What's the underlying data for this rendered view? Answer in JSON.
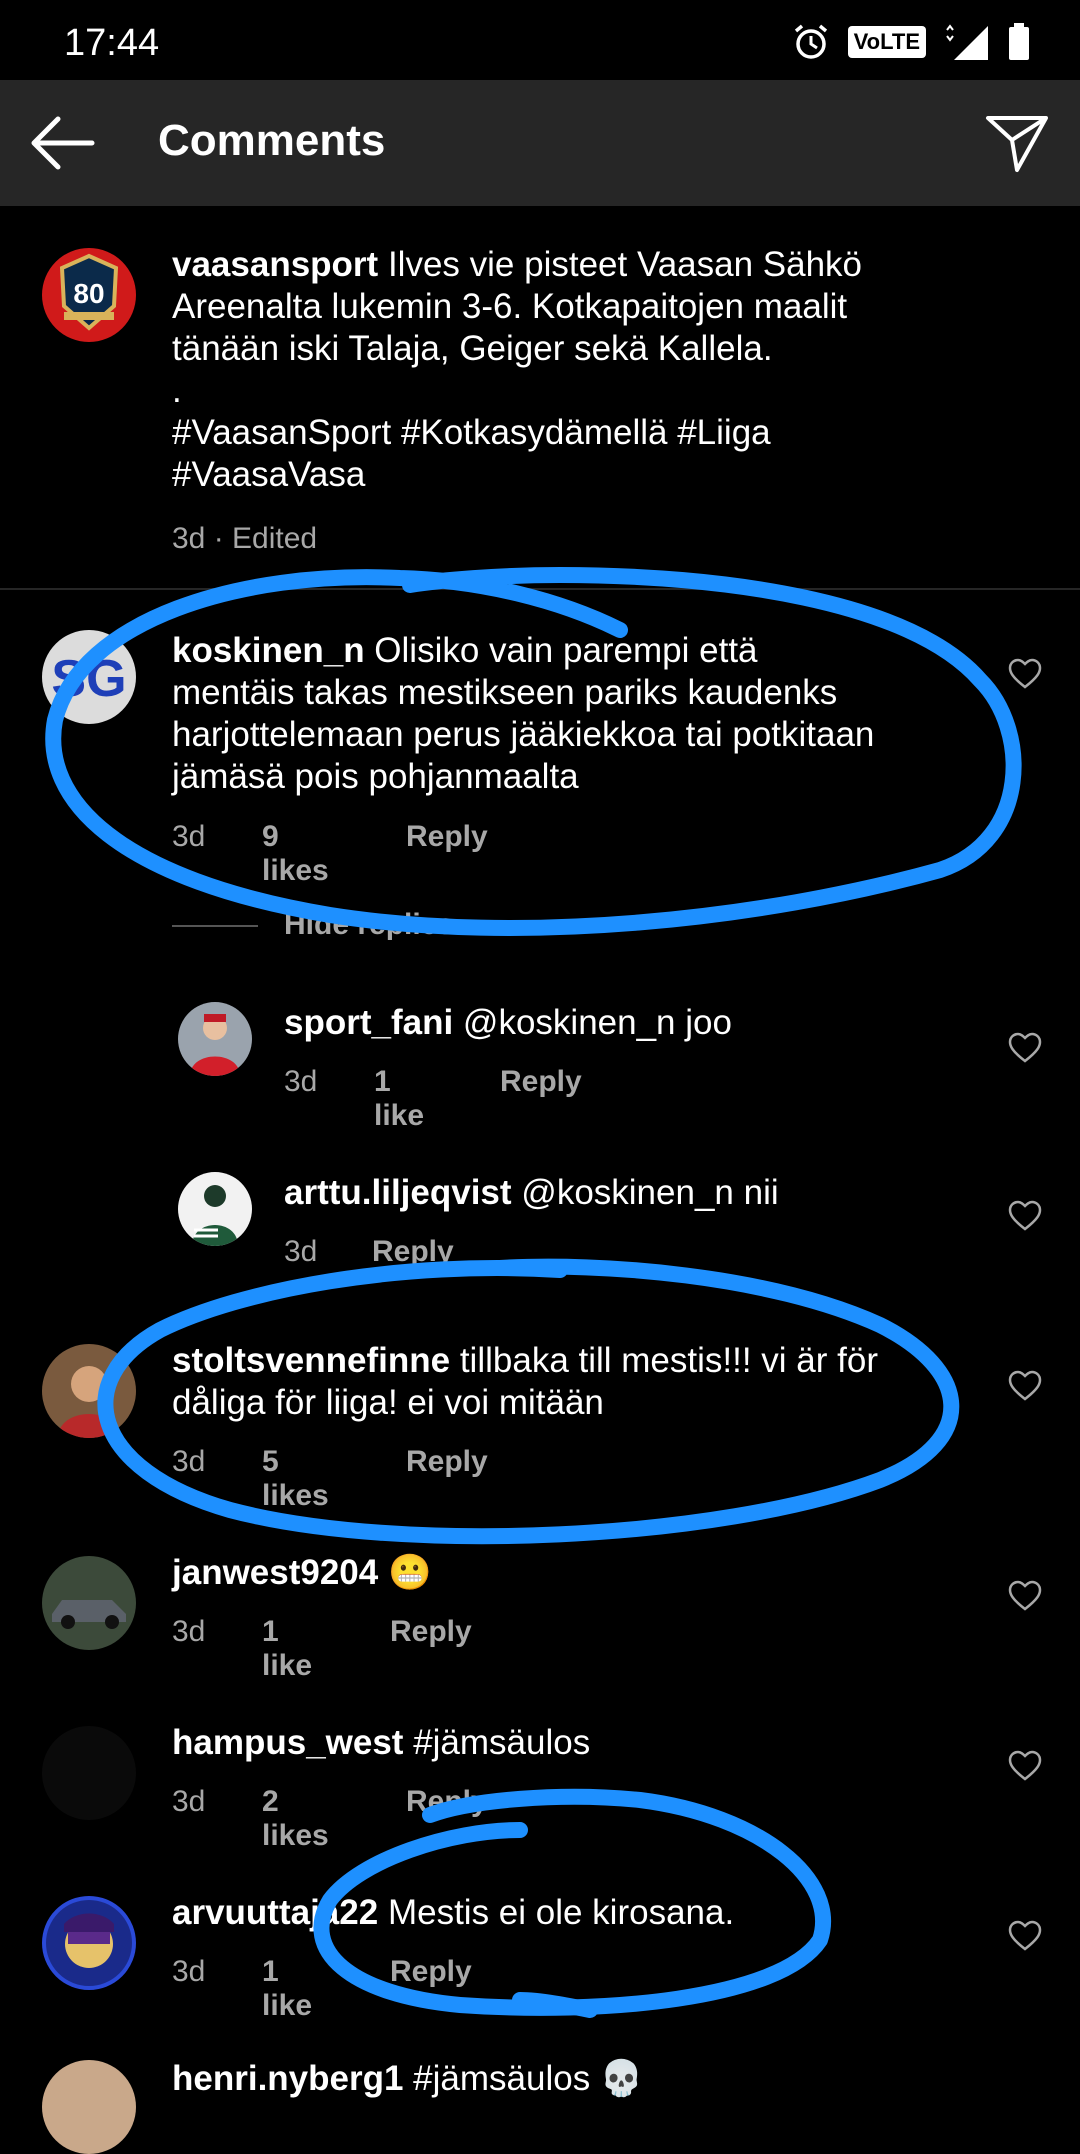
{
  "status_bar": {
    "time": "17:44",
    "volte": "VoLTE",
    "network": "4G+"
  },
  "header": {
    "title": "Comments"
  },
  "caption": {
    "username": "vaasansport",
    "lines": [
      " Ilves vie pisteet Vaasan Sähkö",
      "Areenalta lukemin 3-6. Kotkapaitojen maalit",
      "tänään iski Talaja, Geiger sekä Kallela.",
      ".",
      "#VaasanSport #Kotkasydämellä #Liiga",
      "#VaasaVasa"
    ],
    "meta": "3d · Edited",
    "avatar_text": "80"
  },
  "comments": [
    {
      "username": "koskinen_n",
      "lines": [
        " Olisiko vain parempi että",
        "mentäis takas mestikseen pariks kaudenks",
        "harjottelemaan perus jääkiekkoa tai potkitaan",
        "jämäsä pois pohjanmaalta"
      ],
      "time": "3d",
      "likes": "9 likes",
      "reply": "Reply",
      "avatar_text": "SG"
    },
    {
      "username": "sport_fani",
      "lines": [
        " @koskinen_n joo"
      ],
      "time": "3d",
      "likes": "1 like",
      "reply": "Reply"
    },
    {
      "username": "arttu.liljeqvist",
      "lines": [
        " @koskinen_n nii"
      ],
      "time": "3d",
      "likes": "",
      "reply": "Reply"
    },
    {
      "username": "stoltsvennefinne",
      "lines": [
        " tillbaka till mestis!!! vi är för",
        "dåliga för liiga! ei voi mitään"
      ],
      "time": "3d",
      "likes": "5 likes",
      "reply": "Reply"
    },
    {
      "username": "janwest9204",
      "lines": [
        " 😬"
      ],
      "time": "3d",
      "likes": "1 like",
      "reply": "Reply"
    },
    {
      "username": "hampus_west",
      "lines": [
        " #jämsäulos"
      ],
      "time": "3d",
      "likes": "2 likes",
      "reply": "Reply"
    },
    {
      "username": "arvuuttaja22",
      "lines": [
        " Mestis ei ole kirosana."
      ],
      "time": "3d",
      "likes": "1 like",
      "reply": "Reply"
    },
    {
      "username": "henri.nyberg1",
      "lines": [
        " #jämsäulos 💀"
      ],
      "time": "",
      "likes": "",
      "reply": ""
    }
  ],
  "hide_replies": "Hide replies",
  "colors": {
    "background": "#000000",
    "appbar": "#262626",
    "meta": "#a8a8a8",
    "annotation": "#1e90ff"
  }
}
